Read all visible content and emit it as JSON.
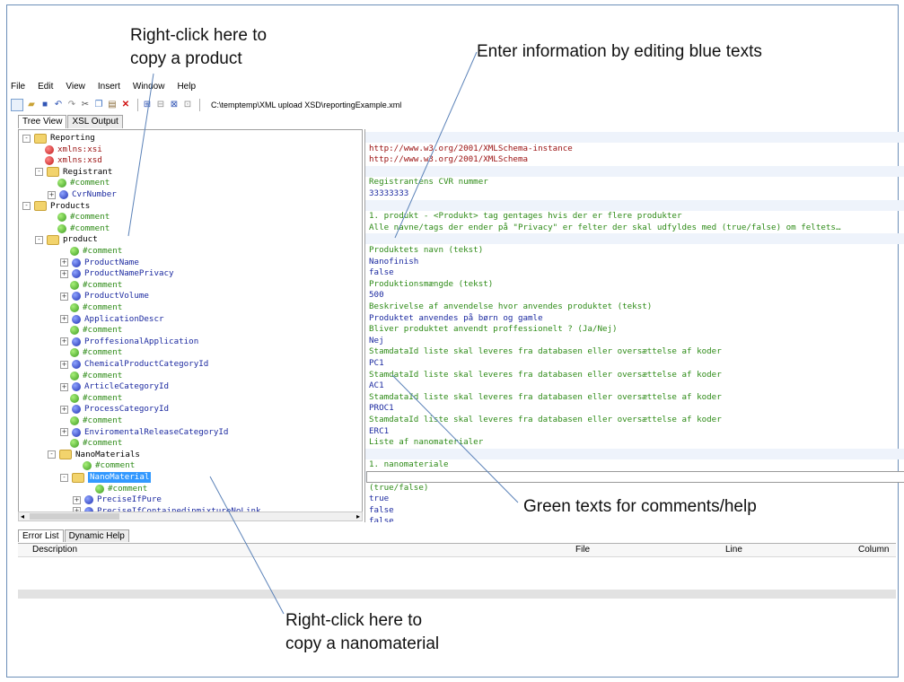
{
  "callouts": {
    "copy_product": "Right-click here to\ncopy a product",
    "edit_blue": "Enter information by editing blue texts",
    "green_help": "Green texts for comments/help",
    "copy_nano": "Right-click here to\ncopy a nanomaterial"
  },
  "menu": [
    "File",
    "Edit",
    "View",
    "Insert",
    "Window",
    "Help"
  ],
  "toolbar": {
    "path": "C:\\temptemp\\XML upload XSD\\reportingExample.xml"
  },
  "tabs": [
    "Tree View",
    "XSL Output"
  ],
  "bottom_tabs": [
    "Error List",
    "Dynamic Help"
  ],
  "error_columns": [
    "Description",
    "File",
    "Line",
    "Column"
  ],
  "icons": {
    "attribute": "red-ball-icon",
    "comment": "green-ball-icon",
    "element": "blue-ball-icon",
    "container": "folder-icon"
  },
  "tree": [
    {
      "label": "Reporting",
      "type": "folder",
      "indent": 0,
      "exp": "-"
    },
    {
      "label": "xmlns:xsi",
      "type": "red",
      "indent": 1
    },
    {
      "label": "xmlns:xsd",
      "type": "red",
      "indent": 1
    },
    {
      "label": "Registrant",
      "type": "folder",
      "indent": 1,
      "exp": "-"
    },
    {
      "label": "#comment",
      "type": "green",
      "indent": 2
    },
    {
      "label": "CvrNumber",
      "type": "blue",
      "indent": 2,
      "exp": "+"
    },
    {
      "label": "Products",
      "type": "folder",
      "indent": 0,
      "exp": "-"
    },
    {
      "label": "#comment",
      "type": "green",
      "indent": 2
    },
    {
      "label": "#comment",
      "type": "green",
      "indent": 2
    },
    {
      "label": "product",
      "type": "folder",
      "indent": 1,
      "exp": "-"
    },
    {
      "label": "#comment",
      "type": "green",
      "indent": 3
    },
    {
      "label": "ProductName",
      "type": "blue",
      "indent": 3,
      "exp": "+"
    },
    {
      "label": "ProductNamePrivacy",
      "type": "blue",
      "indent": 3,
      "exp": "+"
    },
    {
      "label": "#comment",
      "type": "green",
      "indent": 3
    },
    {
      "label": "ProductVolume",
      "type": "blue",
      "indent": 3,
      "exp": "+"
    },
    {
      "label": "#comment",
      "type": "green",
      "indent": 3
    },
    {
      "label": "ApplicationDescr",
      "type": "blue",
      "indent": 3,
      "exp": "+"
    },
    {
      "label": "#comment",
      "type": "green",
      "indent": 3
    },
    {
      "label": "ProffesionalApplication",
      "type": "blue",
      "indent": 3,
      "exp": "+"
    },
    {
      "label": "#comment",
      "type": "green",
      "indent": 3
    },
    {
      "label": "ChemicalProductCategoryId",
      "type": "blue",
      "indent": 3,
      "exp": "+"
    },
    {
      "label": "#comment",
      "type": "green",
      "indent": 3
    },
    {
      "label": "ArticleCategoryId",
      "type": "blue",
      "indent": 3,
      "exp": "+"
    },
    {
      "label": "#comment",
      "type": "green",
      "indent": 3
    },
    {
      "label": "ProcessCategoryId",
      "type": "blue",
      "indent": 3,
      "exp": "+"
    },
    {
      "label": "#comment",
      "type": "green",
      "indent": 3
    },
    {
      "label": "EnviromentalReleaseCategoryId",
      "type": "blue",
      "indent": 3,
      "exp": "+"
    },
    {
      "label": "#comment",
      "type": "green",
      "indent": 3
    },
    {
      "label": "NanoMaterials",
      "type": "folder",
      "indent": 2,
      "exp": "-"
    },
    {
      "label": "#comment",
      "type": "green",
      "indent": 4
    },
    {
      "label": "NanoMaterial",
      "type": "folder",
      "indent": 3,
      "exp": "-",
      "selected": true
    },
    {
      "label": "#comment",
      "type": "green",
      "indent": 5
    },
    {
      "label": "PreciseIfPure",
      "type": "blue",
      "indent": 4,
      "exp": "+"
    },
    {
      "label": "PreciseIfContainedinmixtureNoLink",
      "type": "blue",
      "indent": 4,
      "exp": "+"
    }
  ],
  "values": [
    {
      "row": 1,
      "text": "http://www.w3.org/2001/XMLSchema-instance",
      "type": "red"
    },
    {
      "row": 2,
      "text": "http://www.w3.org/2001/XMLSchema",
      "type": "red"
    },
    {
      "row": 4,
      "text": "Registrantens CVR nummer",
      "type": "green"
    },
    {
      "row": 5,
      "text": "33333333",
      "type": "blue"
    },
    {
      "row": 7,
      "text": "1. produkt - <Produkt> tag gentages hvis der er flere produkter",
      "type": "green"
    },
    {
      "row": 8,
      "text": "Alle navne/tags der ender på \"Privacy\" er felter der skal udfyldes med (true/false) om feltets…",
      "type": "green"
    },
    {
      "row": 10,
      "text": "Produktets navn (tekst)",
      "type": "green"
    },
    {
      "row": 11,
      "text": "Nanofinish",
      "type": "blue"
    },
    {
      "row": 12,
      "text": "false",
      "type": "blue"
    },
    {
      "row": 13,
      "text": "Produktionsmængde (tekst)",
      "type": "green"
    },
    {
      "row": 14,
      "text": "500",
      "type": "blue"
    },
    {
      "row": 15,
      "text": "Beskrivelse af anvendelse hvor anvendes produktet (tekst)",
      "type": "green"
    },
    {
      "row": 16,
      "text": "Produktet anvendes på børn og gamle",
      "type": "blue"
    },
    {
      "row": 17,
      "text": "Bliver produktet anvendt proffessionelt ? (Ja/Nej)",
      "type": "green"
    },
    {
      "row": 18,
      "text": "Nej",
      "type": "blue"
    },
    {
      "row": 19,
      "text": "StamdataId liste skal leveres fra databasen eller oversættelse af koder",
      "type": "green"
    },
    {
      "row": 20,
      "text": "PC1",
      "type": "blue"
    },
    {
      "row": 21,
      "text": "StamdataId liste skal leveres fra databasen eller oversættelse af koder",
      "type": "green"
    },
    {
      "row": 22,
      "text": "AC1",
      "type": "blue"
    },
    {
      "row": 23,
      "text": "StamdataId liste skal leveres fra databasen eller oversættelse af koder",
      "type": "green"
    },
    {
      "row": 24,
      "text": "PROC1",
      "type": "blue"
    },
    {
      "row": 25,
      "text": "StamdataId liste skal leveres fra databasen eller oversættelse af koder",
      "type": "green"
    },
    {
      "row": 26,
      "text": "ERC1",
      "type": "blue"
    },
    {
      "row": 27,
      "text": "Liste af nanomaterialer",
      "type": "green"
    },
    {
      "row": 29,
      "text": "1. nanomateriale",
      "type": "green"
    },
    {
      "row": 31,
      "text": "(true/false)",
      "type": "green"
    },
    {
      "row": 32,
      "text": "true",
      "type": "blue"
    },
    {
      "row": 33,
      "text": "false",
      "type": "blue"
    },
    {
      "row": 34,
      "text": "false",
      "type": "blue"
    }
  ],
  "stripes": [
    0,
    3,
    6,
    9,
    28,
    30
  ]
}
